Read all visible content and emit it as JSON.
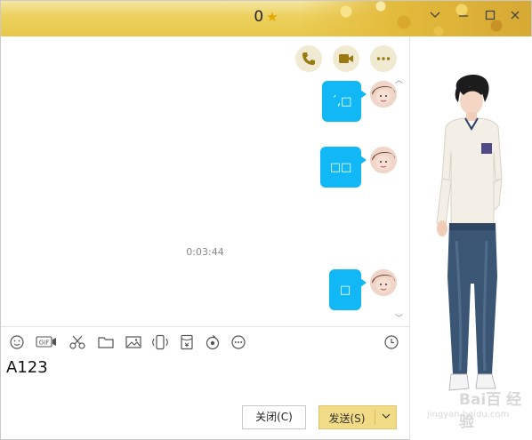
{
  "titlebar": {
    "title": "0",
    "star_icon": "star-icon",
    "buttons": [
      "chevron-down-icon",
      "minimize-icon",
      "maximize-icon",
      "close-icon"
    ]
  },
  "chat": {
    "actions": [
      "phone-icon",
      "video-icon",
      "more-icon"
    ],
    "messages": [
      {
        "text": "´,□"
      },
      {
        "text": "□□"
      },
      {
        "text": "□"
      }
    ],
    "timestamp": "0:03:44",
    "bubble_color": "#12b7f5"
  },
  "toolbar": {
    "tools": [
      "emoji-icon",
      "gif-icon",
      "scissors-icon",
      "folder-icon",
      "image-icon",
      "shake-icon",
      "red-envelope-icon",
      "music-icon",
      "more-icon",
      "clock-icon"
    ],
    "gif_label": "GIF"
  },
  "compose": {
    "value": "A123"
  },
  "buttons": {
    "close_label": "关闭(C)",
    "send_label": "发送(S)"
  },
  "watermark": {
    "line1": "Bai百 经验",
    "line2": "jingyan.baidu.com"
  },
  "colors": {
    "accent": "#12b7f5",
    "titlebar": "#ecd05c",
    "send_button": "#f2db86"
  }
}
